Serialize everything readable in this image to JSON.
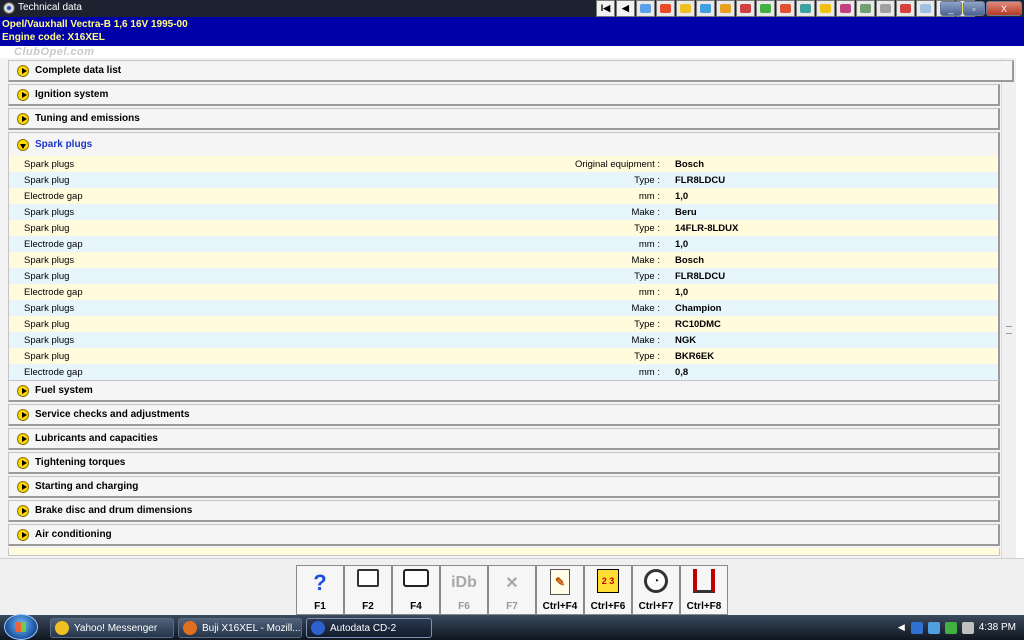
{
  "window": {
    "title": "Technical data",
    "controls": {
      "minimize": "_",
      "restore": "▫",
      "close": "X"
    }
  },
  "toolbar": {
    "nav_first": "I◀",
    "nav_prev": "◀",
    "icon_colors": [
      "#5aa0e8",
      "#e84a2a",
      "#f0c020",
      "#3fa0e0",
      "#e8a020",
      "#d04040",
      "#40b040",
      "#e05030",
      "#3aa0a0",
      "#f0c010",
      "#c04080",
      "#70a070",
      "#a0a0a0",
      "#d84040",
      "#a0c0e0",
      "#60a060",
      "#f0e060"
    ]
  },
  "vehicle": {
    "line1": "Opel/Vauxhall   Vectra-B  1,6 16V 1995-00",
    "line2": "Engine code: X16XEL",
    "watermark": "ClubOpel.com"
  },
  "sections": [
    {
      "label": "Complete data list"
    },
    {
      "label": "Ignition system"
    },
    {
      "label": "Tuning and emissions"
    },
    {
      "label": "Spark plugs"
    },
    {
      "label": "Fuel system"
    },
    {
      "label": "Service checks and adjustments"
    },
    {
      "label": "Lubricants and capacities"
    },
    {
      "label": "Tightening torques"
    },
    {
      "label": "Starting and charging"
    },
    {
      "label": "Brake disc and drum dimensions"
    },
    {
      "label": "Air conditioning"
    }
  ],
  "spark_plug_rows": [
    {
      "name": "Spark plugs",
      "unit": "Original equipment :",
      "value": "Bosch"
    },
    {
      "name": "Spark plug",
      "unit": "Type :",
      "value": "FLR8LDCU"
    },
    {
      "name": "Electrode gap",
      "unit": "mm :",
      "value": "1,0"
    },
    {
      "name": "Spark plugs",
      "unit": "Make :",
      "value": "Beru"
    },
    {
      "name": "Spark plug",
      "unit": "Type :",
      "value": "14FLR-8LDUX"
    },
    {
      "name": "Electrode gap",
      "unit": "mm :",
      "value": "1,0"
    },
    {
      "name": "Spark plugs",
      "unit": "Make :",
      "value": "Bosch"
    },
    {
      "name": "Spark plug",
      "unit": "Type :",
      "value": "FLR8LDCU"
    },
    {
      "name": "Electrode gap",
      "unit": "mm :",
      "value": "1,0"
    },
    {
      "name": "Spark plugs",
      "unit": "Make :",
      "value": "Champion"
    },
    {
      "name": "Spark plug",
      "unit": "Type :",
      "value": "RC10DMC"
    },
    {
      "name": "Spark plugs",
      "unit": "Make :",
      "value": "NGK"
    },
    {
      "name": "Spark plug",
      "unit": "Type :",
      "value": "BKR6EK"
    },
    {
      "name": "Electrode gap",
      "unit": "mm :",
      "value": "0,8"
    }
  ],
  "function_keys": [
    {
      "label": "F1",
      "glyph": "?"
    },
    {
      "label": "F2",
      "glyph": ""
    },
    {
      "label": "F4",
      "glyph": ""
    },
    {
      "label": "F6",
      "glyph": "iDb"
    },
    {
      "label": "F7",
      "glyph": "✕"
    },
    {
      "label": "Ctrl+F4",
      "glyph": "✎"
    },
    {
      "label": "Ctrl+F6",
      "glyph": "2 3"
    },
    {
      "label": "Ctrl+F7",
      "glyph": "◔"
    },
    {
      "label": "Ctrl+F8",
      "glyph": ""
    }
  ],
  "taskbar": {
    "tasks": [
      {
        "label": "Yahoo! Messenger",
        "color": "#f0c020"
      },
      {
        "label": "Buji X16XEL - Mozill...",
        "color": "#e07020"
      },
      {
        "label": "Autodata CD-2",
        "color": "#3060d0"
      }
    ],
    "clock": "4:38 PM",
    "tray_colors": [
      "#3070d0",
      "#50a0e0",
      "#40b040",
      "#c0c0c0"
    ]
  }
}
